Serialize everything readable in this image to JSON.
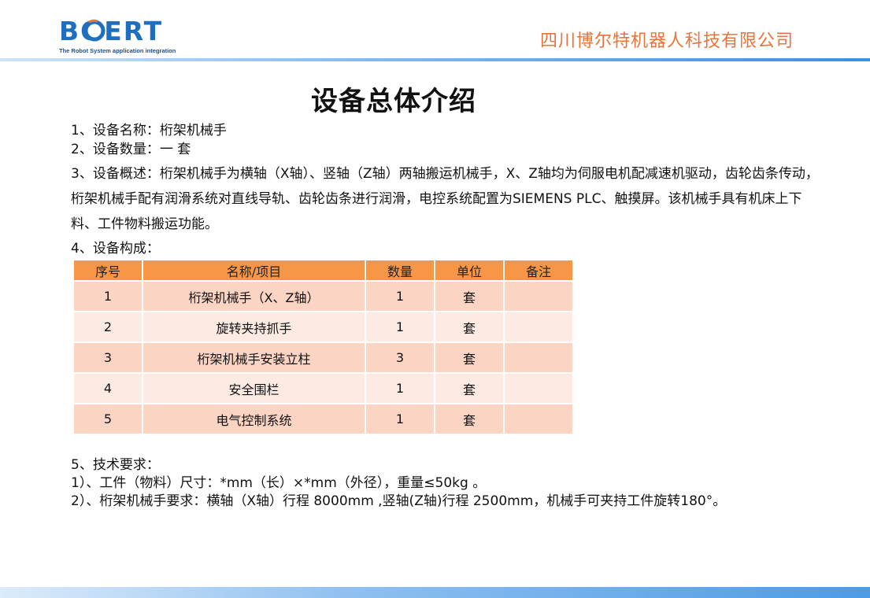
{
  "header": {
    "logo_text": "BOERT",
    "logo_tagline": "The Robot System application integration",
    "company_name": "四川博尔特机器人科技有限公司"
  },
  "title": "设备总体介绍",
  "items": {
    "name_line": "1、设备名称：桁架机械手",
    "qty_line": "2、设备数量：一 套",
    "overview": "3、设备概述：桁架机械手为横轴（X轴）、竖轴（Z轴）两轴搬运机械手，X、Z轴均为伺服电机配减速机驱动，齿轮齿条传动，桁架机械手配有润滑系统对直线导轨、齿轮齿条进行润滑，电控系统配置为SIEMENS PLC、触摸屏。该机械手具有机床上下料、工件物料搬运功能。",
    "composition_line": "4、设备构成："
  },
  "table": {
    "headers": [
      "序号",
      "名称/项目",
      "数量",
      "单位",
      "备注"
    ],
    "rows": [
      [
        "1",
        "桁架机械手（X、Z轴）",
        "1",
        "套",
        ""
      ],
      [
        "2",
        "旋转夹持抓手",
        "1",
        "套",
        ""
      ],
      [
        "3",
        "桁架机械手安装立柱",
        "3",
        "套",
        ""
      ],
      [
        "4",
        "安全围栏",
        "1",
        "套",
        ""
      ],
      [
        "5",
        "电气控制系统",
        "1",
        "套",
        ""
      ]
    ]
  },
  "requirements": {
    "heading": "5、技术要求：",
    "req1": "1）、工件（物料）尺寸：*mm（长）×*mm（外径），重量≤50kg 。",
    "req2": "2）、桁架机械手要求：横轴（X轴）行程 8000mm ,竖轴(Z轴)行程 2500mm，机械手可夹持工件旋转180°。"
  },
  "colors": {
    "brand_blue": "#1f6fc0",
    "company_orange": "#e8743b",
    "table_header": "#f79646",
    "row_dark": "#fbd4c4",
    "row_light": "#fdeae3"
  }
}
